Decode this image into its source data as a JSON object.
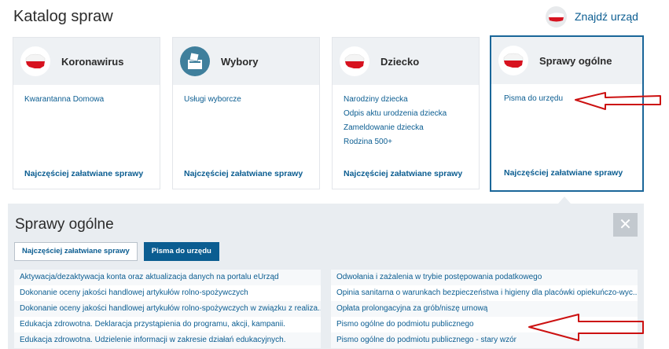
{
  "header": {
    "title": "Katalog spraw",
    "find_office": "Znajdź urząd"
  },
  "cards": [
    {
      "title": "Koronawirus",
      "icon": "poland-map-icon",
      "links": [
        "Kwarantanna Domowa"
      ],
      "footer": "Najczęściej załatwiane sprawy"
    },
    {
      "title": "Wybory",
      "icon": "ballot-box-icon",
      "links": [
        "Usługi wyborcze"
      ],
      "footer": "Najczęściej załatwiane sprawy"
    },
    {
      "title": "Dziecko",
      "icon": "poland-map-icon",
      "links": [
        "Narodziny dziecka",
        "Odpis aktu urodzenia dziecka",
        "Zameldowanie dziecka",
        "Rodzina 500+"
      ],
      "footer": "Najczęściej załatwiane sprawy"
    },
    {
      "title": "Sprawy ogólne",
      "icon": "poland-map-icon",
      "links": [
        "Pisma do urzędu"
      ],
      "footer": "Najczęściej załatwiane sprawy"
    }
  ],
  "panel": {
    "title": "Sprawy ogólne",
    "close": "✕",
    "tabs": [
      "Najczęściej załatwiane sprawy",
      "Pisma do urzędu"
    ],
    "active_tab": 1,
    "left_items": [
      "Aktywacja/dezaktywacja konta oraz aktualizacja danych na portalu eUrząd",
      "Dokonanie oceny jakości handlowej artykułów rolno-spożywczych",
      "Dokonanie oceny jakości handlowej artykułów rolno-spożywczych w związku z realiza...",
      "Edukacja zdrowotna. Deklaracja przystąpienia do programu, akcji, kampanii.",
      "Edukacja zdrowotna. Udzielenie informacji w zakresie działań edukacyjnych."
    ],
    "right_items": [
      "Odwołania i zażalenia w trybie postępowania podatkowego",
      "Opinia sanitarna o warunkach bezpieczeństwa i higieny dla placówki opiekuńczo-wyc...",
      "Opłata prolongacyjna za grób/niszę urnową",
      "Pismo ogólne do podmiotu publicznego",
      "Pismo ogólne do podmiotu publicznego - stary wzór"
    ]
  },
  "colors": {
    "link": "#0b5d91",
    "card_head": "#eef1f4",
    "panel_bg": "#e9edf1",
    "active_border": "#1a6699",
    "annotation_arrow": "#cc1111"
  }
}
